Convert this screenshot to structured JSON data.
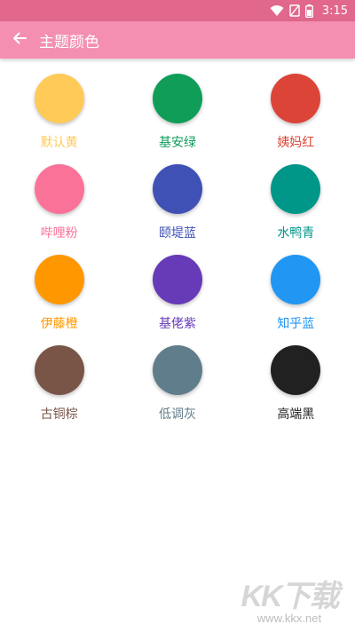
{
  "status_bar": {
    "time": "3:15",
    "icons": [
      "wifi-icon",
      "no-signal-icon",
      "battery-icon"
    ]
  },
  "app_bar": {
    "title": "主题颜色",
    "back_icon": "arrow-left-icon"
  },
  "colors": [
    {
      "label": "默认黄",
      "color": "#FFCA57"
    },
    {
      "label": "基安绿",
      "color": "#0F9D58"
    },
    {
      "label": "姨妈红",
      "color": "#DB4437"
    },
    {
      "label": "哔哩粉",
      "color": "#FB7299"
    },
    {
      "label": "颐堤蓝",
      "color": "#3F51B5"
    },
    {
      "label": "水鸭青",
      "color": "#009688"
    },
    {
      "label": "伊藤橙",
      "color": "#FF9800"
    },
    {
      "label": "基佬紫",
      "color": "#673AB7"
    },
    {
      "label": "知乎蓝",
      "color": "#2196F3"
    },
    {
      "label": "古铜棕",
      "color": "#795548"
    },
    {
      "label": "低调灰",
      "color": "#607D8B"
    },
    {
      "label": "高端黑",
      "color": "#212121"
    }
  ],
  "watermark": {
    "logo": "KK下载",
    "url": "www.kkx.net"
  }
}
